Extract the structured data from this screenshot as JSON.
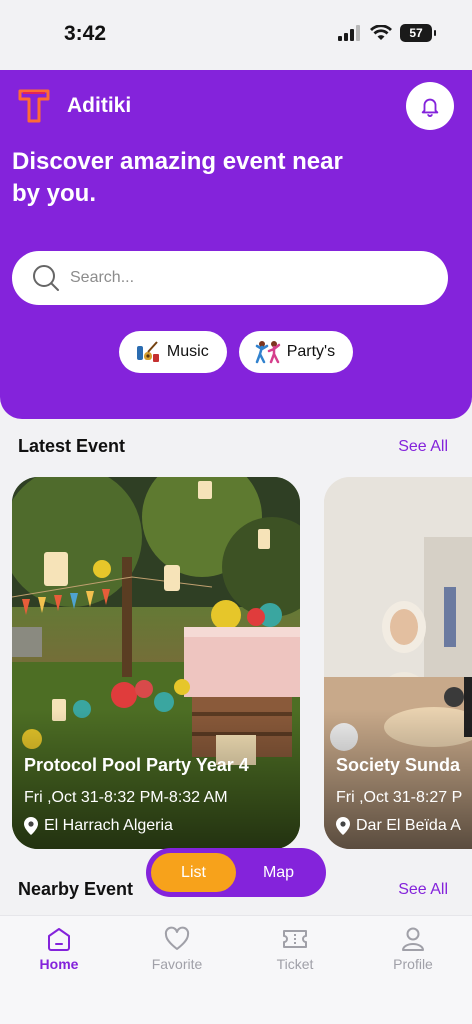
{
  "status_bar": {
    "time": "3:42",
    "battery": "57"
  },
  "header": {
    "app_name": "Aditiki",
    "headline": "Discover amazing event near by you.",
    "search_placeholder": "Search...",
    "categories": [
      {
        "label": "Music",
        "icon": "music-instruments-icon"
      },
      {
        "label": "Party's",
        "icon": "dancing-people-icon"
      }
    ]
  },
  "latest": {
    "title": "Latest Event",
    "see_all": "See All",
    "events": [
      {
        "title": "Protocol Pool Party Year 4",
        "date": "Fri ,Oct 31-8:32 PM-8:32 AM",
        "location": "El Harrach Algeria"
      },
      {
        "title": "Society Sunda",
        "date": "Fri ,Oct 31-8:27 P",
        "location": "Dar El Beïda A"
      }
    ]
  },
  "view_toggle": {
    "list": "List",
    "map": "Map",
    "active": "List"
  },
  "nearby": {
    "title": "Nearby Event",
    "see_all": "See All"
  },
  "tabbar": {
    "tabs": [
      {
        "label": "Home",
        "icon": "home-icon",
        "active": true
      },
      {
        "label": "Favorite",
        "icon": "heart-icon",
        "active": false
      },
      {
        "label": "Ticket",
        "icon": "ticket-icon",
        "active": false
      },
      {
        "label": "Profile",
        "icon": "profile-icon",
        "active": false
      }
    ]
  },
  "colors": {
    "brand": "#8423db",
    "accent": "#f7a21b",
    "background": "#f2f2f4"
  }
}
